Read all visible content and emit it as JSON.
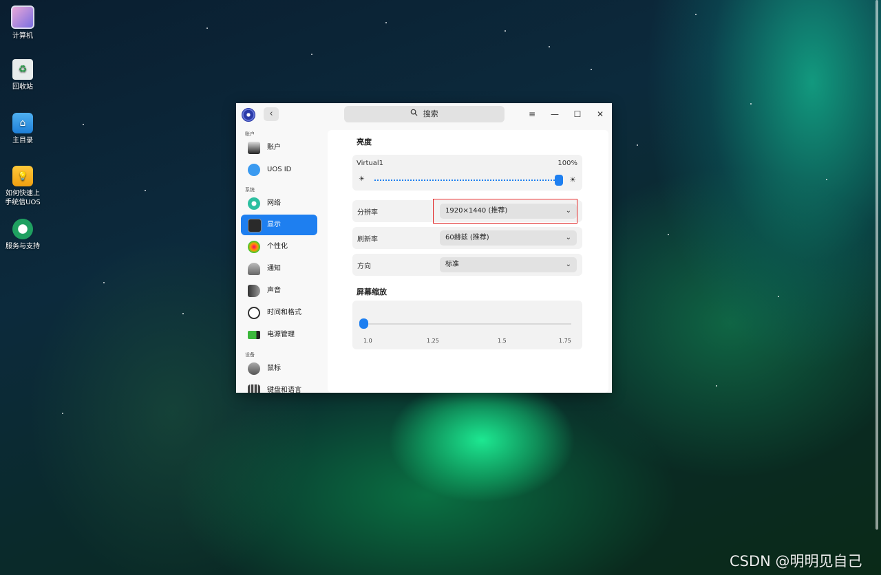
{
  "desktop": {
    "icons": [
      {
        "label": "计算机",
        "icon": "computer-icon"
      },
      {
        "label": "回收站",
        "icon": "trash-icon"
      },
      {
        "label": "主目录",
        "icon": "home-folder-icon"
      },
      {
        "label_line1": "如何快速上",
        "label_line2": "手统信UOS",
        "icon": "uos-guide-icon"
      },
      {
        "label": "服务与支持",
        "icon": "support-icon"
      }
    ],
    "watermark": "CSDN @明明见自己"
  },
  "window": {
    "search_placeholder": "搜索",
    "back_symbol": "‹",
    "menu_symbol": "≡",
    "minimize_symbol": "—",
    "maximize_symbol": "☐",
    "close_symbol": "✕",
    "sidebar": {
      "group_account": "账户",
      "group_system": "系统",
      "group_devices": "设备",
      "items": [
        {
          "label": "账户",
          "icon": "account-icon"
        },
        {
          "label": "UOS ID",
          "icon": "cloud-icon"
        },
        {
          "label": "网络",
          "icon": "network-icon"
        },
        {
          "label": "显示",
          "icon": "display-icon",
          "active": true
        },
        {
          "label": "个性化",
          "icon": "personalization-icon"
        },
        {
          "label": "通知",
          "icon": "bell-icon"
        },
        {
          "label": "声音",
          "icon": "speaker-icon"
        },
        {
          "label": "时间和格式",
          "icon": "clock-icon"
        },
        {
          "label": "电源管理",
          "icon": "battery-icon"
        },
        {
          "label": "鼠标",
          "icon": "mouse-icon"
        },
        {
          "label": "键盘和语言",
          "icon": "keyboard-icon"
        }
      ]
    },
    "display": {
      "brightness_title": "亮度",
      "monitor_name": "Virtual1",
      "brightness_percent": "100%",
      "brightness_value": 1.0,
      "resolution_label": "分辨率",
      "resolution_value": "1920×1440 (推荐)",
      "refresh_label": "刷新率",
      "refresh_value": "60赫兹 (推荐)",
      "orientation_label": "方向",
      "orientation_value": "标准",
      "scale_title": "屏幕缩放",
      "scale_ticks": [
        "1.0",
        "1.25",
        "1.5",
        "1.75"
      ],
      "scale_value": 1.0,
      "chevron": "⌄"
    }
  },
  "colors": {
    "accent": "#1e7ff0",
    "highlight_border": "#e02020"
  }
}
